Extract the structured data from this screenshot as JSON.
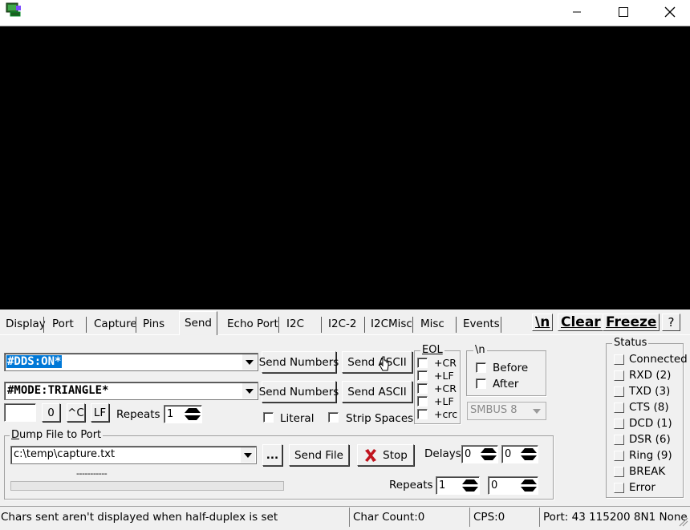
{
  "window": {
    "icon": "terminal-app-icon",
    "controls": {
      "minimize": "minimize-icon",
      "maximize": "maximize-icon",
      "close": "close-icon"
    }
  },
  "tabs": [
    "Display",
    "Port",
    "Capture",
    "Pins",
    "Send",
    "Echo Port",
    "I2C",
    "I2C-2",
    "I2CMisc",
    "Misc",
    "Events"
  ],
  "active_tab": "Send",
  "toolbar": {
    "newline": "\\n",
    "clear": "Clear",
    "freeze": "Freeze",
    "help": "?"
  },
  "send": {
    "line1": {
      "value": "#DDS:ON*",
      "send_numbers": "Send Numbers",
      "send_ascii": "Send ASCII"
    },
    "line2": {
      "value": "#MODE:TRIANGLE*",
      "send_numbers": "Send Numbers",
      "send_ascii": "Send ASCII"
    },
    "zero_btn": "0",
    "ctrl_c_btn": "^C",
    "lf_btn": "LF",
    "repeats_label": "Repeats",
    "repeats_value": "1",
    "literal_label": "Literal",
    "strip_spaces_label": "Strip Spaces"
  },
  "eol": {
    "title": "EOL",
    "options": [
      "+CR",
      "+LF",
      "+CR",
      "+LF",
      "+crc"
    ]
  },
  "newline_group": {
    "title": "\\n",
    "before": "Before",
    "after": "After",
    "smbus": "SMBUS 8"
  },
  "dump": {
    "title": "Dump File to Port",
    "file": "c:\\temp\\capture.txt",
    "browse": "...",
    "send_file": "Send File",
    "stop": "Stop",
    "delays_label": "Delays",
    "delay1": "0",
    "delay2": "0",
    "progress_text": "-----------",
    "progress": 0,
    "repeats_label": "Repeats",
    "repeats1": "1",
    "repeats2": "0"
  },
  "status": {
    "title": "Status",
    "items": [
      "Connected",
      "RXD (2)",
      "TXD (3)",
      "CTS (8)",
      "DCD (1)",
      "DSR (6)",
      "Ring (9)",
      "BREAK",
      "Error"
    ]
  },
  "statusbar": {
    "message": "Chars sent aren't displayed when half-duplex is set",
    "char_count": "Char Count:0",
    "cps": "CPS:0",
    "port": "Port: 43 115200 8N1 None"
  },
  "colors": {
    "terminal_bg": "#000000",
    "selection": "#0078d7",
    "stop_icon": "#c0141e"
  }
}
